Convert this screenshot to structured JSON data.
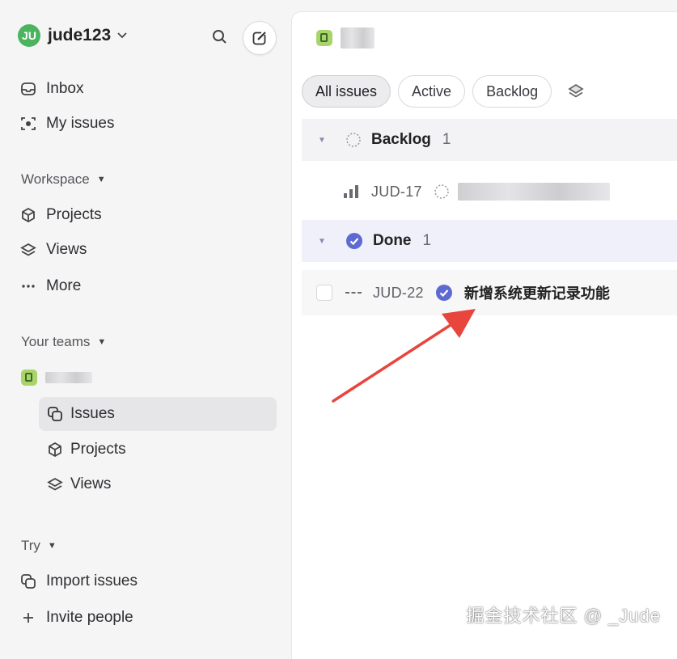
{
  "workspace": {
    "initials": "JU",
    "name": "jude123"
  },
  "nav": {
    "inbox": "Inbox",
    "my_issues": "My issues"
  },
  "workspace_section": {
    "label": "Workspace",
    "projects": "Projects",
    "views": "Views",
    "more": "More"
  },
  "teams_section": {
    "label": "Your teams",
    "issues": "Issues",
    "projects": "Projects",
    "views": "Views"
  },
  "try_section": {
    "label": "Try",
    "import": "Import issues",
    "invite": "Invite people"
  },
  "filters": [
    "All issues",
    "Active",
    "Backlog"
  ],
  "groups": {
    "backlog": {
      "name": "Backlog",
      "count": "1"
    },
    "done": {
      "name": "Done",
      "count": "1"
    }
  },
  "issues": [
    {
      "id": "JUD-17",
      "title": ""
    },
    {
      "id": "JUD-22",
      "title": "新增系统更新记录功能"
    }
  ],
  "watermark": "掘金技术社区 @ _Jude",
  "colors": {
    "avatar": "#4cb35e",
    "done_accent": "#5e6ad2",
    "arrow": "#e8453c"
  }
}
